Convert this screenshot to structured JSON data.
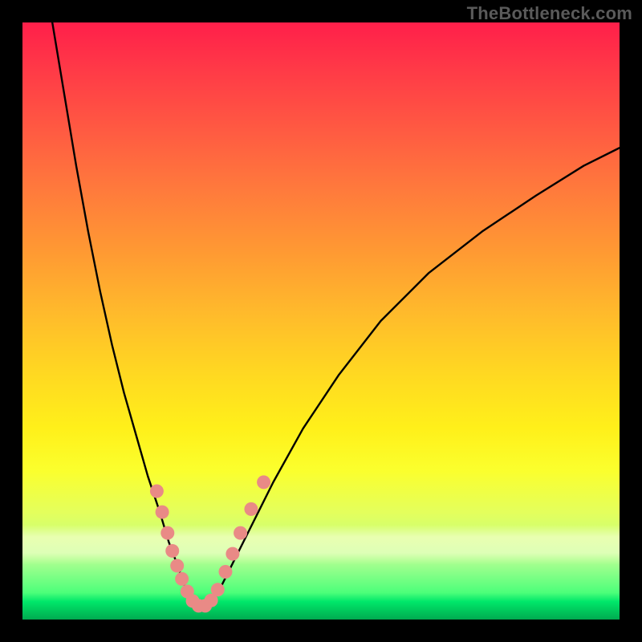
{
  "watermark": "TheBottleneck.com",
  "chart_data": {
    "type": "line",
    "title": "",
    "xlabel": "",
    "ylabel": "",
    "xlim": [
      0,
      100
    ],
    "ylim": [
      0,
      100
    ],
    "grid": false,
    "legend": false,
    "notes": "V-shaped bottleneck curve over vertical red-to-green gradient. No axis ticks or labels are visible; x and y values are normalized 0-100 estimates read from pixel positions. Pink markers cluster along the curve near the trough.",
    "series": [
      {
        "name": "left-arm",
        "x": [
          5,
          7,
          9,
          11,
          13,
          15,
          17,
          19,
          21,
          23,
          24.5,
          26,
          27,
          28,
          28.8
        ],
        "y": [
          100,
          88,
          76,
          65,
          55,
          46,
          38,
          31,
          24,
          18,
          13,
          9,
          6,
          4,
          2.5
        ]
      },
      {
        "name": "right-arm",
        "x": [
          31.5,
          33,
          35,
          38,
          42,
          47,
          53,
          60,
          68,
          77,
          86,
          94,
          100
        ],
        "y": [
          2.5,
          5,
          9,
          15,
          23,
          32,
          41,
          50,
          58,
          65,
          71,
          76,
          79
        ]
      },
      {
        "name": "valley-floor",
        "x": [
          28.8,
          29.5,
          30.5,
          31.5
        ],
        "y": [
          2.5,
          2.2,
          2.2,
          2.5
        ]
      }
    ],
    "markers": {
      "name": "pink-dots",
      "color": "#e98a86",
      "points": [
        {
          "x": 22.5,
          "y": 21.5
        },
        {
          "x": 23.4,
          "y": 18.0
        },
        {
          "x": 24.3,
          "y": 14.5
        },
        {
          "x": 25.1,
          "y": 11.5
        },
        {
          "x": 25.9,
          "y": 9.0
        },
        {
          "x": 26.7,
          "y": 6.8
        },
        {
          "x": 27.6,
          "y": 4.7
        },
        {
          "x": 28.5,
          "y": 3.1
        },
        {
          "x": 29.5,
          "y": 2.3
        },
        {
          "x": 30.6,
          "y": 2.3
        },
        {
          "x": 31.6,
          "y": 3.2
        },
        {
          "x": 32.7,
          "y": 5.0
        },
        {
          "x": 34.0,
          "y": 8.0
        },
        {
          "x": 35.2,
          "y": 11.0
        },
        {
          "x": 36.5,
          "y": 14.5
        },
        {
          "x": 38.3,
          "y": 18.5
        },
        {
          "x": 40.4,
          "y": 23.0
        }
      ]
    },
    "background_gradient": {
      "direction": "top-to-bottom",
      "stops": [
        {
          "pos": 0.0,
          "color": "#ff1f4a"
        },
        {
          "pos": 0.35,
          "color": "#ff8f36"
        },
        {
          "pos": 0.65,
          "color": "#ffe31e"
        },
        {
          "pos": 0.8,
          "color": "#f5ff3f"
        },
        {
          "pos": 0.96,
          "color": "#2fef72"
        },
        {
          "pos": 1.0,
          "color": "#00aa50"
        }
      ]
    }
  }
}
